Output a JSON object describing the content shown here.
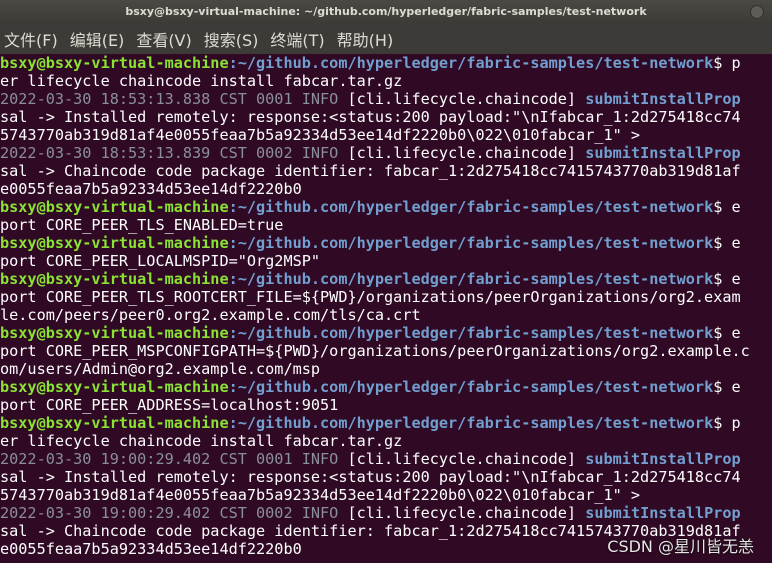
{
  "window": {
    "title": "bsxy@bsxy-virtual-machine: ~/github.com/hyperledger/fabric-samples/test-network"
  },
  "menu": [
    "文件(F)",
    "编辑(E)",
    "查看(V)",
    "搜索(S)",
    "终端(T)",
    "帮助(H)"
  ],
  "terminal": {
    "user": "bsxy@bsxy-virtual-machine",
    "path": ":~/github.com/hyperledger/fabric-samples/test-network",
    "log_ctx": "[cli.lifecycle.chaincode]",
    "lines": [
      {
        "type": "prompt",
        "cmd": "$ p"
      },
      {
        "type": "text",
        "text": "er lifecycle chaincode install fabcar.tar.gz"
      },
      {
        "type": "log",
        "ts": "2022-03-30 18:53:13.838 CST 0001 INFO",
        "fn": "submitInstallProp"
      },
      {
        "type": "text",
        "text": "sal -> Installed remotely: response:<status:200 payload:\"\\nIfabcar_1:2d275418cc74"
      },
      {
        "type": "text",
        "text": "5743770ab319d81af4e0055feaa7b5a92334d53ee14df2220b0\\022\\010fabcar_1\" >"
      },
      {
        "type": "log",
        "ts": "2022-03-30 18:53:13.839 CST 0002 INFO",
        "fn": "submitInstallProp"
      },
      {
        "type": "text",
        "text": "sal -> Chaincode code package identifier: fabcar_1:2d275418cc7415743770ab319d81af"
      },
      {
        "type": "text",
        "text": "e0055feaa7b5a92334d53ee14df2220b0"
      },
      {
        "type": "prompt",
        "cmd": "$ e"
      },
      {
        "type": "text",
        "text": "port CORE_PEER_TLS_ENABLED=true"
      },
      {
        "type": "prompt",
        "cmd": "$ e"
      },
      {
        "type": "text",
        "text": "port CORE_PEER_LOCALMSPID=\"Org2MSP\""
      },
      {
        "type": "prompt",
        "cmd": "$ e"
      },
      {
        "type": "text",
        "text": "port CORE_PEER_TLS_ROOTCERT_FILE=${PWD}/organizations/peerOrganizations/org2.exam"
      },
      {
        "type": "text",
        "text": "le.com/peers/peer0.org2.example.com/tls/ca.crt"
      },
      {
        "type": "prompt",
        "cmd": "$ e"
      },
      {
        "type": "text",
        "text": "port CORE_PEER_MSPCONFIGPATH=${PWD}/organizations/peerOrganizations/org2.example.c"
      },
      {
        "type": "text",
        "text": "om/users/Admin@org2.example.com/msp"
      },
      {
        "type": "prompt",
        "cmd": "$ e"
      },
      {
        "type": "text",
        "text": "port CORE_PEER_ADDRESS=localhost:9051"
      },
      {
        "type": "prompt",
        "cmd": "$ p"
      },
      {
        "type": "text",
        "text": "er lifecycle chaincode install fabcar.tar.gz"
      },
      {
        "type": "log",
        "ts": "2022-03-30 19:00:29.402 CST 0001 INFO",
        "fn": "submitInstallProp"
      },
      {
        "type": "text",
        "text": "sal -> Installed remotely: response:<status:200 payload:\"\\nIfabcar_1:2d275418cc74"
      },
      {
        "type": "text",
        "text": "5743770ab319d81af4e0055feaa7b5a92334d53ee14df2220b0\\022\\010fabcar_1\" >"
      },
      {
        "type": "log",
        "ts": "2022-03-30 19:00:29.402 CST 0002 INFO",
        "fn": "submitInstallProp"
      },
      {
        "type": "text",
        "text": "sal -> Chaincode code package identifier: fabcar_1:2d275418cc7415743770ab319d81af"
      },
      {
        "type": "text",
        "text": "e0055feaa7b5a92334d53ee14df2220b0"
      }
    ]
  },
  "watermark": "CSDN @星川皆无恙",
  "colors": {
    "background": "#300a24",
    "user": "#8ae234",
    "path": "#729fcf"
  }
}
